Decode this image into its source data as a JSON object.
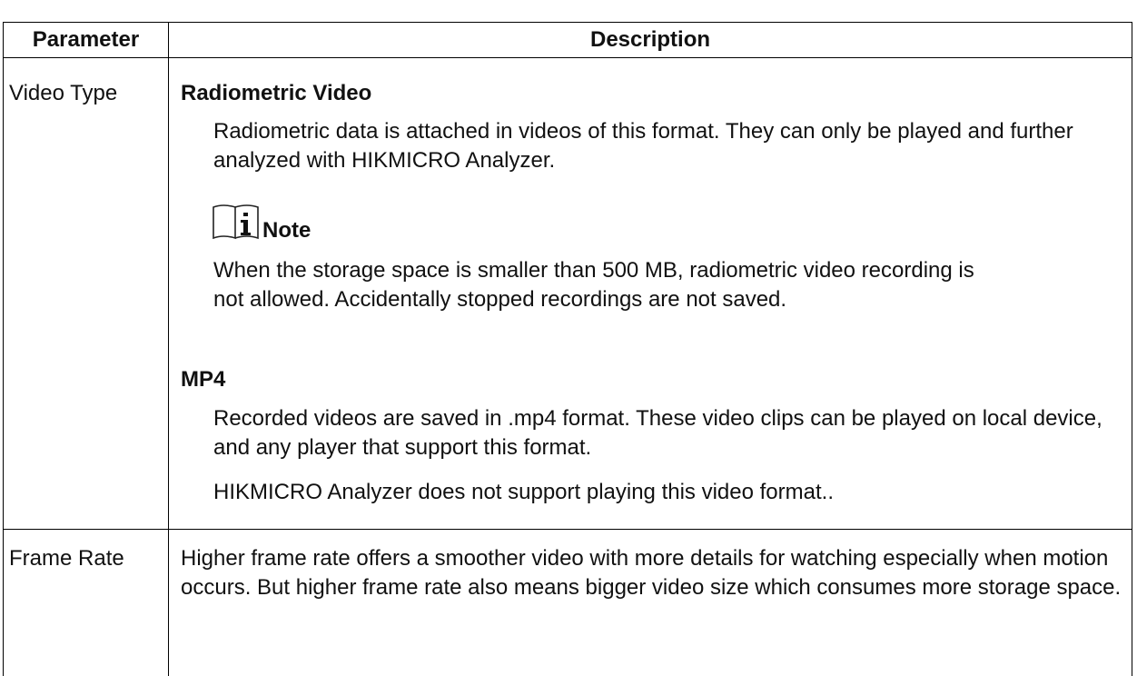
{
  "table": {
    "headers": {
      "parameter": "Parameter",
      "description": "Description"
    },
    "rows": [
      {
        "parameter": "Video Type",
        "sections": {
          "radiometric": {
            "title": "Radiometric Video",
            "text": "Radiometric data is attached in videos of this format. They can only be played and further analyzed with HIKMICRO Analyzer.",
            "note_label": "Note",
            "note_icon": "info-book-icon",
            "note_text": "When the storage space is smaller than 500 MB, radiometric video recording is not allowed. Accidentally stopped recordings are not saved."
          },
          "mp4": {
            "title": "MP4",
            "text": "Recorded videos are saved in .mp4 format. These video clips can be played on local device, and any player that support this format.",
            "extra": "HIKMICRO Analyzer does not support playing this video format.."
          }
        }
      },
      {
        "parameter": "Frame Rate",
        "text": "Higher frame rate offers a smoother video with more details for watching especially when motion occurs. But higher frame rate also means bigger video size which consumes more storage space."
      }
    ]
  }
}
